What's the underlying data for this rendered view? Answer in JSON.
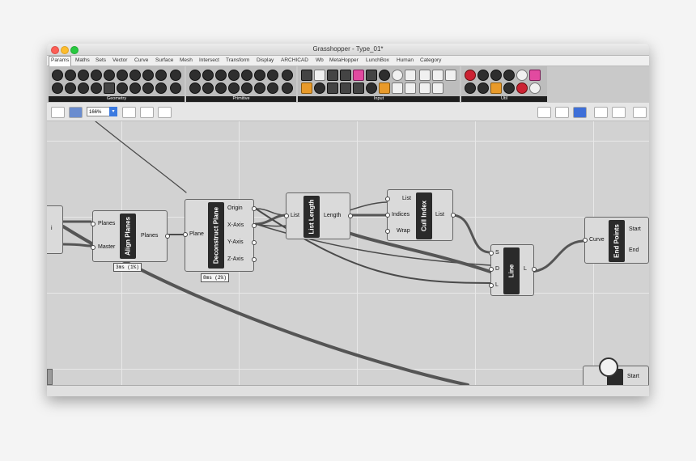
{
  "window": {
    "title": "Grasshopper - Type_01*"
  },
  "menu": [
    {
      "label": "Params",
      "active": true
    },
    {
      "label": "Maths"
    },
    {
      "label": "Sets"
    },
    {
      "label": "Vector"
    },
    {
      "label": "Curve"
    },
    {
      "label": "Surface"
    },
    {
      "label": "Mesh"
    },
    {
      "label": "Intersect"
    },
    {
      "label": "Transform"
    },
    {
      "label": "Display"
    },
    {
      "label": "ARCHICAD"
    },
    {
      "label": "Wb"
    },
    {
      "label": "MetaHopper"
    },
    {
      "label": "LunchBox"
    },
    {
      "label": "Human"
    },
    {
      "label": "Category"
    }
  ],
  "ribbon_groups": [
    {
      "label": "Geometry"
    },
    {
      "label": "Primitive"
    },
    {
      "label": "Input"
    },
    {
      "label": "Util"
    }
  ],
  "toolbar": {
    "zoom": "166%"
  },
  "components": {
    "align_planes": {
      "name": "Align Planes",
      "inputs": [
        "Planes",
        "Master"
      ],
      "outputs": [
        "Planes"
      ],
      "timer": "3ms (1%)"
    },
    "deconstruct_plane": {
      "name": "Deconstruct Plane",
      "inputs": [
        "Plane"
      ],
      "outputs": [
        "Origin",
        "X-Axis",
        "Y-Axis",
        "Z-Axis"
      ],
      "timer": "8ms (2%)"
    },
    "list_length": {
      "name": "List Length",
      "inputs": [
        "List"
      ],
      "outputs": [
        "Length"
      ]
    },
    "cull_index": {
      "name": "Cull Index",
      "inputs": [
        "List",
        "Indices",
        "Wrap"
      ],
      "outputs": [
        "List"
      ]
    },
    "line": {
      "name": "Line",
      "inputs": [
        "S",
        "D",
        "L"
      ],
      "outputs": [
        "L"
      ]
    },
    "end_points": {
      "name": "End Points",
      "inputs": [
        "Curve"
      ],
      "outputs": [
        "Start",
        "End"
      ]
    },
    "partial": {
      "output": "Start"
    },
    "left_partial": {
      "label": "i"
    }
  }
}
